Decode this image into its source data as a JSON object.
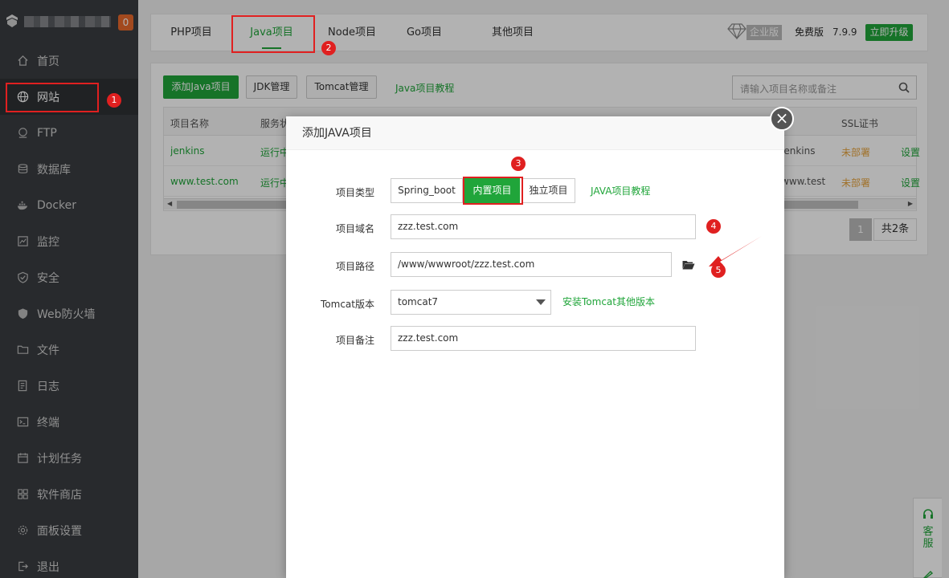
{
  "sidebar": {
    "badge": "0",
    "items": [
      {
        "label": "首页",
        "icon": "home-icon"
      },
      {
        "label": "网站",
        "icon": "globe-icon"
      },
      {
        "label": "FTP",
        "icon": "ftp-icon"
      },
      {
        "label": "数据库",
        "icon": "database-icon"
      },
      {
        "label": "Docker",
        "icon": "docker-icon"
      },
      {
        "label": "监控",
        "icon": "monitor-icon"
      },
      {
        "label": "安全",
        "icon": "shield-icon"
      },
      {
        "label": "Web防火墙",
        "icon": "firewall-icon"
      },
      {
        "label": "文件",
        "icon": "folder-icon"
      },
      {
        "label": "日志",
        "icon": "log-icon"
      },
      {
        "label": "终端",
        "icon": "terminal-icon"
      },
      {
        "label": "计划任务",
        "icon": "calendar-icon"
      },
      {
        "label": "软件商店",
        "icon": "apps-icon"
      },
      {
        "label": "面板设置",
        "icon": "gear-icon"
      },
      {
        "label": "退出",
        "icon": "logout-icon"
      }
    ]
  },
  "topnav": {
    "tabs": [
      "PHP项目",
      "Java项目",
      "Node项目",
      "Go项目",
      "其他项目"
    ],
    "edition_badge": "企业版",
    "free_version": "免费版",
    "version": "7.9.9",
    "upgrade": "立即升级"
  },
  "toolbar": {
    "add_button": "添加Java项目",
    "jdk_button": "JDK管理",
    "tomcat_button": "Tomcat管理",
    "tutorial_link": "Java项目教程",
    "search_placeholder": "请输入项目名称或备注"
  },
  "table": {
    "headers": [
      "项目名称",
      "服务状",
      "",
      "SSL证书"
    ],
    "rows": [
      {
        "name": "jenkins",
        "status": "运行中",
        "note": "jenkins",
        "ssl": "未部署",
        "action": "设置"
      },
      {
        "name": "www.test.com",
        "status": "运行中",
        "note": "www.test.c",
        "ssl": "未部署",
        "action": "设置"
      }
    ],
    "page": "1",
    "total": "共2条"
  },
  "modal": {
    "title": "添加JAVA项目",
    "type_label": "项目类型",
    "type_options": [
      "Spring_boot",
      "内置项目",
      "独立项目"
    ],
    "type_selected": "内置项目",
    "type_tutorial": "JAVA项目教程",
    "domain_label": "项目域名",
    "domain_value": "zzz.test.com",
    "path_label": "项目路径",
    "path_value": "/www/wwwroot/zzz.test.com",
    "tomcat_label": "Tomcat版本",
    "tomcat_value": "tomcat7",
    "tomcat_install": "安装Tomcat其他版本",
    "remark_label": "项目备注",
    "remark_value": "zzz.test.com"
  },
  "widget": {
    "label": "客服"
  },
  "annotations": [
    "1",
    "2",
    "3",
    "4",
    "5"
  ],
  "colors": {
    "accent": "#20a53a",
    "sidebar": "#3a3d41",
    "annotation": "#e02020",
    "warning": "#e6a23c"
  }
}
